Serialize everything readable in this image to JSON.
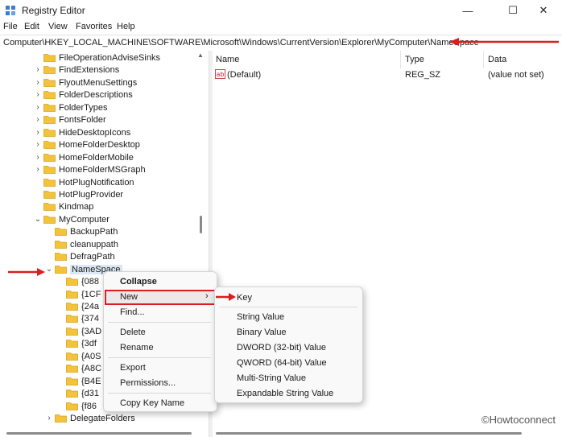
{
  "window": {
    "title": "Registry Editor",
    "minimize": "—",
    "maximize": "☐",
    "close": "✕"
  },
  "menu": [
    "File",
    "Edit",
    "View",
    "Favorites",
    "Help"
  ],
  "address": "Computer\\HKEY_LOCAL_MACHINE\\SOFTWARE\\Microsoft\\Windows\\CurrentVersion\\Explorer\\MyComputer\\NameSpace",
  "tree": [
    {
      "label": "FileOperationAdviseSinks",
      "chev": ""
    },
    {
      "label": "FindExtensions",
      "chev": "›"
    },
    {
      "label": "FlyoutMenuSettings",
      "chev": "›"
    },
    {
      "label": "FolderDescriptions",
      "chev": "›"
    },
    {
      "label": "FolderTypes",
      "chev": "›"
    },
    {
      "label": "FontsFolder",
      "chev": "›"
    },
    {
      "label": "HideDesktopIcons",
      "chev": "›"
    },
    {
      "label": "HomeFolderDesktop",
      "chev": "›"
    },
    {
      "label": "HomeFolderMobile",
      "chev": "›"
    },
    {
      "label": "HomeFolderMSGraph",
      "chev": "›"
    },
    {
      "label": "HotPlugNotification",
      "chev": ""
    },
    {
      "label": "HotPlugProvider",
      "chev": ""
    },
    {
      "label": "Kindmap",
      "chev": ""
    },
    {
      "label": "MyComputer",
      "chev": "⌄"
    },
    {
      "label": "BackupPath",
      "chev": ""
    },
    {
      "label": "cleanuppath",
      "chev": ""
    },
    {
      "label": "DefragPath",
      "chev": ""
    },
    {
      "label": "NameSpace",
      "chev": "⌄"
    },
    {
      "label": "{088",
      "chev": ""
    },
    {
      "label": "{1CF",
      "chev": ""
    },
    {
      "label": "{24a",
      "chev": ""
    },
    {
      "label": "{374",
      "chev": ""
    },
    {
      "label": "{3AD",
      "chev": ""
    },
    {
      "label": "{3df",
      "chev": ""
    },
    {
      "label": "{A0S",
      "chev": ""
    },
    {
      "label": "{A8C",
      "chev": ""
    },
    {
      "label": "{B4E",
      "chev": ""
    },
    {
      "label": "{d31",
      "chev": ""
    },
    {
      "label": "{f86",
      "chev": ""
    },
    {
      "label": "DelegateFolders",
      "chev": "›"
    }
  ],
  "list": {
    "columns": [
      "Name",
      "Type",
      "Data"
    ],
    "rows": [
      {
        "name": "(Default)",
        "type": "REG_SZ",
        "data": "(value not set)"
      }
    ]
  },
  "context_menu": {
    "collapse": "Collapse",
    "new": "New",
    "new_arrow": "›",
    "find": "Find...",
    "delete": "Delete",
    "rename": "Rename",
    "export": "Export",
    "permissions": "Permissions...",
    "copy_key_name": "Copy Key Name"
  },
  "submenu": {
    "key": "Key",
    "string": "String Value",
    "binary": "Binary Value",
    "dword": "DWORD (32-bit) Value",
    "qword": "QWORD (64-bit) Value",
    "multi": "Multi-String Value",
    "expandable": "Expandable String Value"
  },
  "watermark": "©Howtoconnect",
  "colors": {
    "annotation_red": "#d81e1e",
    "folder_yellow": "#f3c33b",
    "selection": "#dde8f5"
  }
}
